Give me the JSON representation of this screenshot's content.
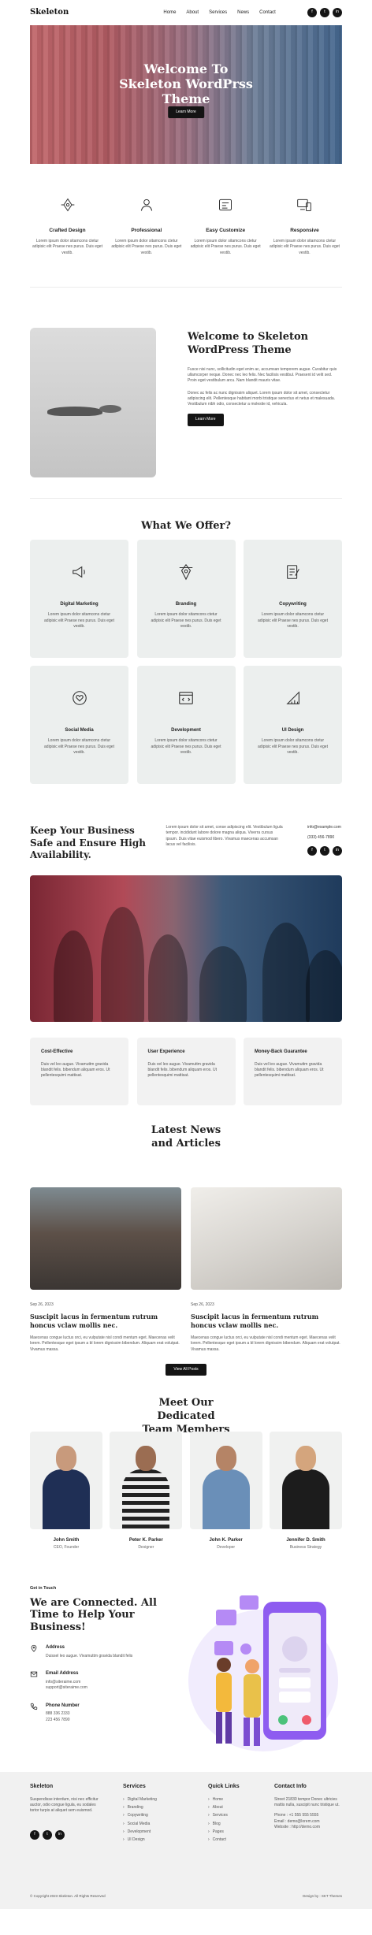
{
  "header": {
    "logo": "Skeleton",
    "nav": [
      "Home",
      "About",
      "Services",
      "News",
      "Contact"
    ],
    "social": [
      "f",
      "t",
      "in"
    ]
  },
  "hero": {
    "title": "Welcome To Skeleton WordPrss Theme",
    "button": "Learn More"
  },
  "features": [
    {
      "title": "Crafted Design",
      "text": "Lorem ipsum dolor sitamcons ctetur adipisic elit Praese nes purus. Duis eget vestib."
    },
    {
      "title": "Professional",
      "text": "Lorem ipsum dolor sitamcons ctetur adipisic elit Praese nes purus. Duis eget vestib."
    },
    {
      "title": "Easy Customize",
      "text": "Lorem ipsum dolor sitamcons ctetur adipisic elit Praese nes purus. Duis eget vestib."
    },
    {
      "title": "Responsive",
      "text": "Lorem ipsum dolor sitamcons ctetur adipisic elit Praese nes purus. Duis eget vestib."
    }
  ],
  "welcome": {
    "title": "Welcome to Skeleton WordPress Theme",
    "p1": "Fusce nisi nunc, sollicitudin eget enim ac, accumsan temporem augue. Curabitur quis ullamcorper neque. Donec nec leo felis. Nec facilisis vestibul. Praesent id velit sed. Proin eget vestibulum arcu. Nam blandit mauris vitae.",
    "p2": "Donec ac felis ac nunc dignissim aliquet. Lorem ipsum dolor sit amet, consectetur adipiscing elit. Pellentesque habitant morbi tristique senectus et netus et malesuada. Vestibulum nibh odio, consectetur a molestie id, vehicula.",
    "button": "Learn More"
  },
  "offer": {
    "title": "What We Offer?",
    "cards": [
      {
        "title": "Digital Marketing",
        "text": "Lorem ipsum dolor sitamcons ctetur adipisic elit Praese nes purus. Duis eget vestib."
      },
      {
        "title": "Branding",
        "text": "Lorem ipsum dolor sitamcons ctetur adipisic elit Praese nes purus. Duis eget vestib."
      },
      {
        "title": "Copywriting",
        "text": "Lorem ipsum dolor sitamcons ctetur adipisic elit Praese nes purus. Duis eget vestib."
      },
      {
        "title": "Social Media",
        "text": "Lorem ipsum dolor sitamcons ctetur adipisic elit Praese nes purus. Duis eget vestib."
      },
      {
        "title": "Development",
        "text": "Lorem ipsum dolor sitamcons ctetur adipisic elit Praese nes purus. Duis eget vestib."
      },
      {
        "title": "UI Design",
        "text": "Lorem ipsum dolor sitamcons ctetur adipisic elit Praese nes purus. Duis eget vestib."
      }
    ]
  },
  "business": {
    "title": "Keep Your Business Safe and Ensure High Availability.",
    "text": "Lorem ipsum dolor sit amet, conse adipiscing elit. Vestibulum ligula tempor. incididunt labore dolore magna aliqua. Viverra cursus ipsum. Duis vitae euismod libero. Vivamus maecenas accumsan lacus vel facilisis.",
    "email": "info@example.com",
    "phone": "(333) 456-7890",
    "social": [
      "f",
      "t",
      "in"
    ]
  },
  "benefits": [
    {
      "title": "Cost-Effective",
      "text": "Duis vel leo augue. Vivamuttm gravida blandit felis. bibendum aliquam eros. Ut pellentesquimi mattisat."
    },
    {
      "title": "User Experience",
      "text": "Duis vel leo augue. Vivamuttm gravida blandit felis. bibendum aliquam eros. Ut pellentesquimi mattisat."
    },
    {
      "title": "Money-Back Guarantee",
      "text": "Duis vel leo augue. Vivamuttm gravida blandit felis. bibendum aliquam eros. Ut pellentesquimi mattisat."
    }
  ],
  "news": {
    "title": "Latest News and Articles",
    "button": "View All Posts",
    "posts": [
      {
        "date": "Sep 26, 2023",
        "title": "Suscipit lacus in fermentum rutrum honcus vclaw mollis nec.",
        "text": "Maecenas congue luctus orci, eu vulputate nisl condi mentum eget. Maecenas velit lorem. Pellentesque eget ipsum a bl lorem dignissim bibendum. Aliquam erat volutpat. Vivamus massa."
      },
      {
        "date": "Sep 26, 2023",
        "title": "Suscipit lacus in fermentum rutrum honcus vclaw mollis nec.",
        "text": "Maecenas congue luctus orci, eu vulputate nisl condi mentum eget. Maecenas velit lorem. Pellentesque eget ipsum a bl lorem dignissim bibendum. Aliquam erat volutpat. Vivamus massa."
      }
    ]
  },
  "team": {
    "title": "Meet Our Dedicated Team Members",
    "members": [
      {
        "name": "John Smith",
        "role": "CEO, Founder"
      },
      {
        "name": "Peter K. Parker",
        "role": "Designer"
      },
      {
        "name": "John K. Parker",
        "role": "Developer"
      },
      {
        "name": "Jennifer D. Smith",
        "role": "Business Strategy"
      }
    ]
  },
  "contact": {
    "eyebrow": "Get in Touch",
    "title": "We are Connected. All Time to Help Your Business!",
    "address_label": "Address",
    "address": "Duissel leo augue. Vivamuttm gravida blandit felis",
    "email_label": "Email Address",
    "email1": "info@siteraime.com",
    "email2": "support@siteraime.com",
    "phone_label": "Phone Number",
    "phone1": "888 336 2333",
    "phone2": "223 456 7890"
  },
  "footer": {
    "about_title": "Skeleton",
    "about": "Suspendisse interdum, nisi nec efficitur auctor, odio congue ligula, eu sodales tortor turpis at aliquet sem euismod.",
    "services_title": "Services",
    "services": [
      "Digital Marketing",
      "Branding",
      "Copywriting",
      "Social Media",
      "Development",
      "UI Design"
    ],
    "links_title": "Quick Links",
    "links": [
      "Home",
      "About",
      "Services",
      "Blog",
      "Pages",
      "Contact"
    ],
    "info_title": "Contact Info",
    "info_address": "Street 21830 tempor Donec ultricies mattis nulla, suscipit nunc tristique ut.",
    "info_phone": "Phone   : +1 555 555 5555",
    "info_email": "Email   : demo@lorem.com",
    "info_web": "Website : http://demo.com",
    "social": [
      "f",
      "t",
      "in"
    ],
    "copyright": "© Copyright 2023 Skeleton. All Rights Reserved",
    "credit": "Design by : SKT Themes"
  },
  "colors": {
    "dark": "#141414",
    "card_bg": "#ecefee",
    "footer_bg": "#f1f1f1",
    "accent_purple": "#8e5cf0"
  }
}
